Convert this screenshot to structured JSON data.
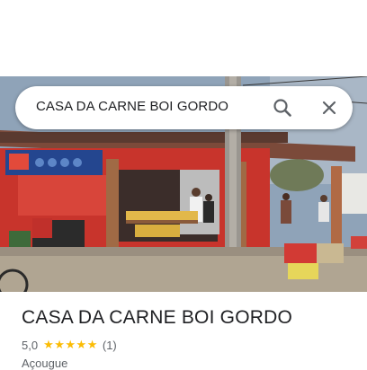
{
  "search": {
    "query": "CASA DA CARNE BOI GORDO",
    "search_icon": "search-icon",
    "close_icon": "close-icon"
  },
  "photo": {
    "banner_text": "",
    "sign_right": "",
    "subject": "storefront"
  },
  "place": {
    "title": "CASA DA CARNE BOI GORDO",
    "rating": "5,0",
    "stars": "★★★★★",
    "review_count": "(1)",
    "category": "Açougue"
  },
  "colors": {
    "star": "#fbbc04",
    "title": "#202124",
    "secondary": "#5f6368",
    "storefront_red": "#c8342c"
  }
}
